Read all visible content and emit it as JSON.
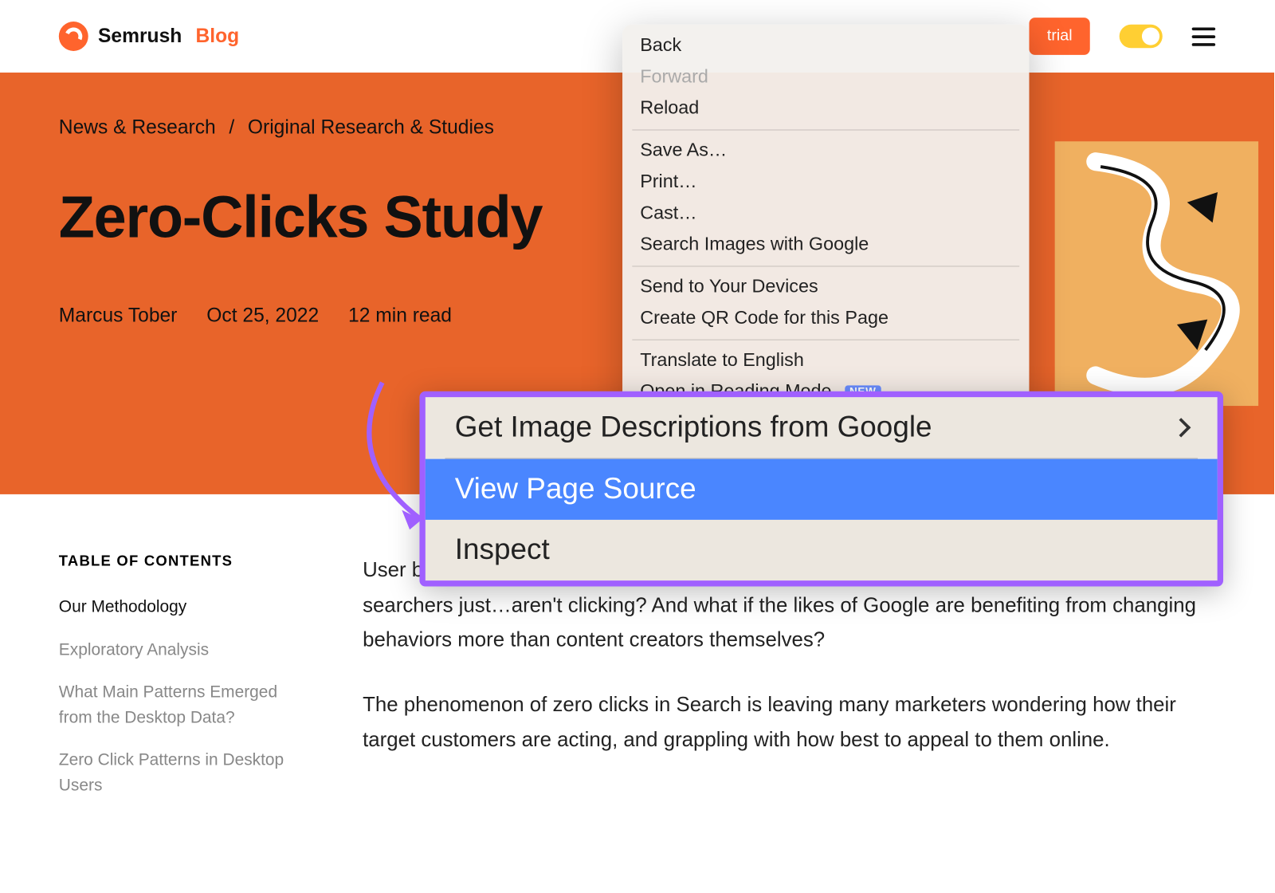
{
  "header": {
    "brand_a": "Semrush",
    "brand_b": "Blog",
    "trial_label": "trial"
  },
  "breadcrumb": {
    "a": "News & Research",
    "sep": "/",
    "b": "Original Research & Studies"
  },
  "page_title": "Zero-Clicks Study",
  "meta": {
    "author": "Marcus Tober",
    "date": "Oct 25, 2022",
    "read": "12 min read"
  },
  "toc": {
    "title": "TABLE OF CONTENTS",
    "items": [
      {
        "label": "Our Methodology",
        "active": true
      },
      {
        "label": "Exploratory Analysis",
        "active": false
      },
      {
        "label": "What Main Patterns Emerged from the Desktop Data?",
        "active": false
      },
      {
        "label": "Zero Click Patterns in Desktop Users",
        "active": false
      }
    ]
  },
  "article": {
    "p1": "User behaviors are tough to predict at the best of times in SEO, but what if more and more searchers just…aren't clicking? And what if the likes of Google are benefiting from changing behaviors more than content creators themselves?",
    "p2": "The phenomenon of zero clicks in Search is leaving many marketers wondering how their target customers are acting, and grappling with how best to appeal to them online."
  },
  "context_menu": {
    "back": "Back",
    "forward": "Forward",
    "reload": "Reload",
    "save_as": "Save As…",
    "print": "Print…",
    "cast": "Cast…",
    "search_images": "Search Images with Google",
    "send_devices": "Send to Your Devices",
    "qr": "Create QR Code for this Page",
    "translate": "Translate to English",
    "reading": "Open in Reading Mode",
    "new_badge": "NEW"
  },
  "zoom": {
    "img_desc": "Get Image Descriptions from Google",
    "view_source": "View Page Source",
    "inspect": "Inspect"
  }
}
